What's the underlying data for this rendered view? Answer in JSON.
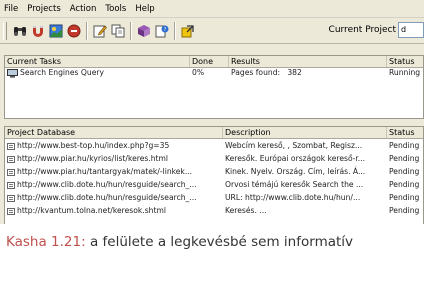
{
  "menu": [
    "File",
    "Projects",
    "Action",
    "Tools",
    "Help"
  ],
  "toolbar": {
    "icons": [
      "binoculars-icon",
      "magnet-icon",
      "image-icon",
      "stop-icon",
      "edit-icon",
      "copy-icon",
      "cube-icon",
      "help-icon",
      "export-icon"
    ],
    "current_project_label": "Current Project",
    "current_project_value": "d"
  },
  "tasks": {
    "headers": [
      "Current Tasks",
      "Done",
      "Results",
      "Status"
    ],
    "rows": [
      {
        "name": "Search Engines Query",
        "done": "0%",
        "results": "Pages found:   382",
        "status": "Running"
      }
    ]
  },
  "database": {
    "headers": [
      "Project Database",
      "Description",
      "Status"
    ],
    "rows": [
      {
        "url": "http://www.best-top.hu/index.php?g=35",
        "desc": "Webcím kereső, , Szombat, Regisz...",
        "status": "Pending"
      },
      {
        "url": "http://www.piar.hu/kyrios/list/keres.html",
        "desc": "Keresők. Európai országok kereső-r...",
        "status": "Pending"
      },
      {
        "url": "http://www.piar.hu/tantargyak/matek/-linkek...",
        "desc": "Kinek. Nyelv. Ország. Cím, leírás. Á...",
        "status": "Pending"
      },
      {
        "url": "http://www.clib.dote.hu/hun/resguide/search_...",
        "desc": "Orvosi témájú keresők Search the ...",
        "status": "Pending"
      },
      {
        "url": "http://www.clib.dote.hu/hun/resguide/search_...",
        "desc": "URL: http://www.clib.dote.hu/hun/...",
        "status": "Pending"
      },
      {
        "url": "http://kvantum.tolna.net/keresok.shtml",
        "desc": "Keresés. ...",
        "status": "Pending"
      }
    ]
  },
  "caption": {
    "label": "Kasha 1.21:",
    "text": " a felülete a legkevésbé sem informatív"
  },
  "colors": {
    "window_bg": "#ece9d8",
    "caption_label": "#c0504d",
    "caption_text": "#333333"
  }
}
